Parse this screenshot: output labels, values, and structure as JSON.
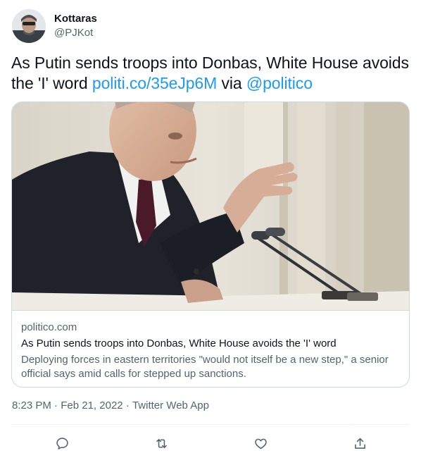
{
  "author": {
    "display_name": "Kottaras",
    "handle": "@PJKot"
  },
  "tweet": {
    "text_before_link": "As Putin sends troops into Donbas, White House avoids the 'I' word ",
    "link_text": "politi.co/35eJp6M",
    "text_via": " via ",
    "mention": "@politico"
  },
  "card": {
    "domain": "politico.com",
    "title": "As Putin sends troops into Donbas, White House avoids the 'I' word",
    "description": "Deploying forces in eastern territories \"would not itself be a new step,\" a senior official says amid calls for stepped up sanctions."
  },
  "meta": {
    "time": "8:23 PM",
    "separator": " · ",
    "date": "Feb 21, 2022",
    "source": "Twitter Web App"
  },
  "actions": {
    "reply_icon": "reply-icon",
    "retweet_icon": "retweet-icon",
    "like_icon": "like-icon",
    "share_icon": "share-icon"
  },
  "colors": {
    "link": "#1d9bf0",
    "secondary_text": "#536471",
    "border": "#cfd9de"
  }
}
